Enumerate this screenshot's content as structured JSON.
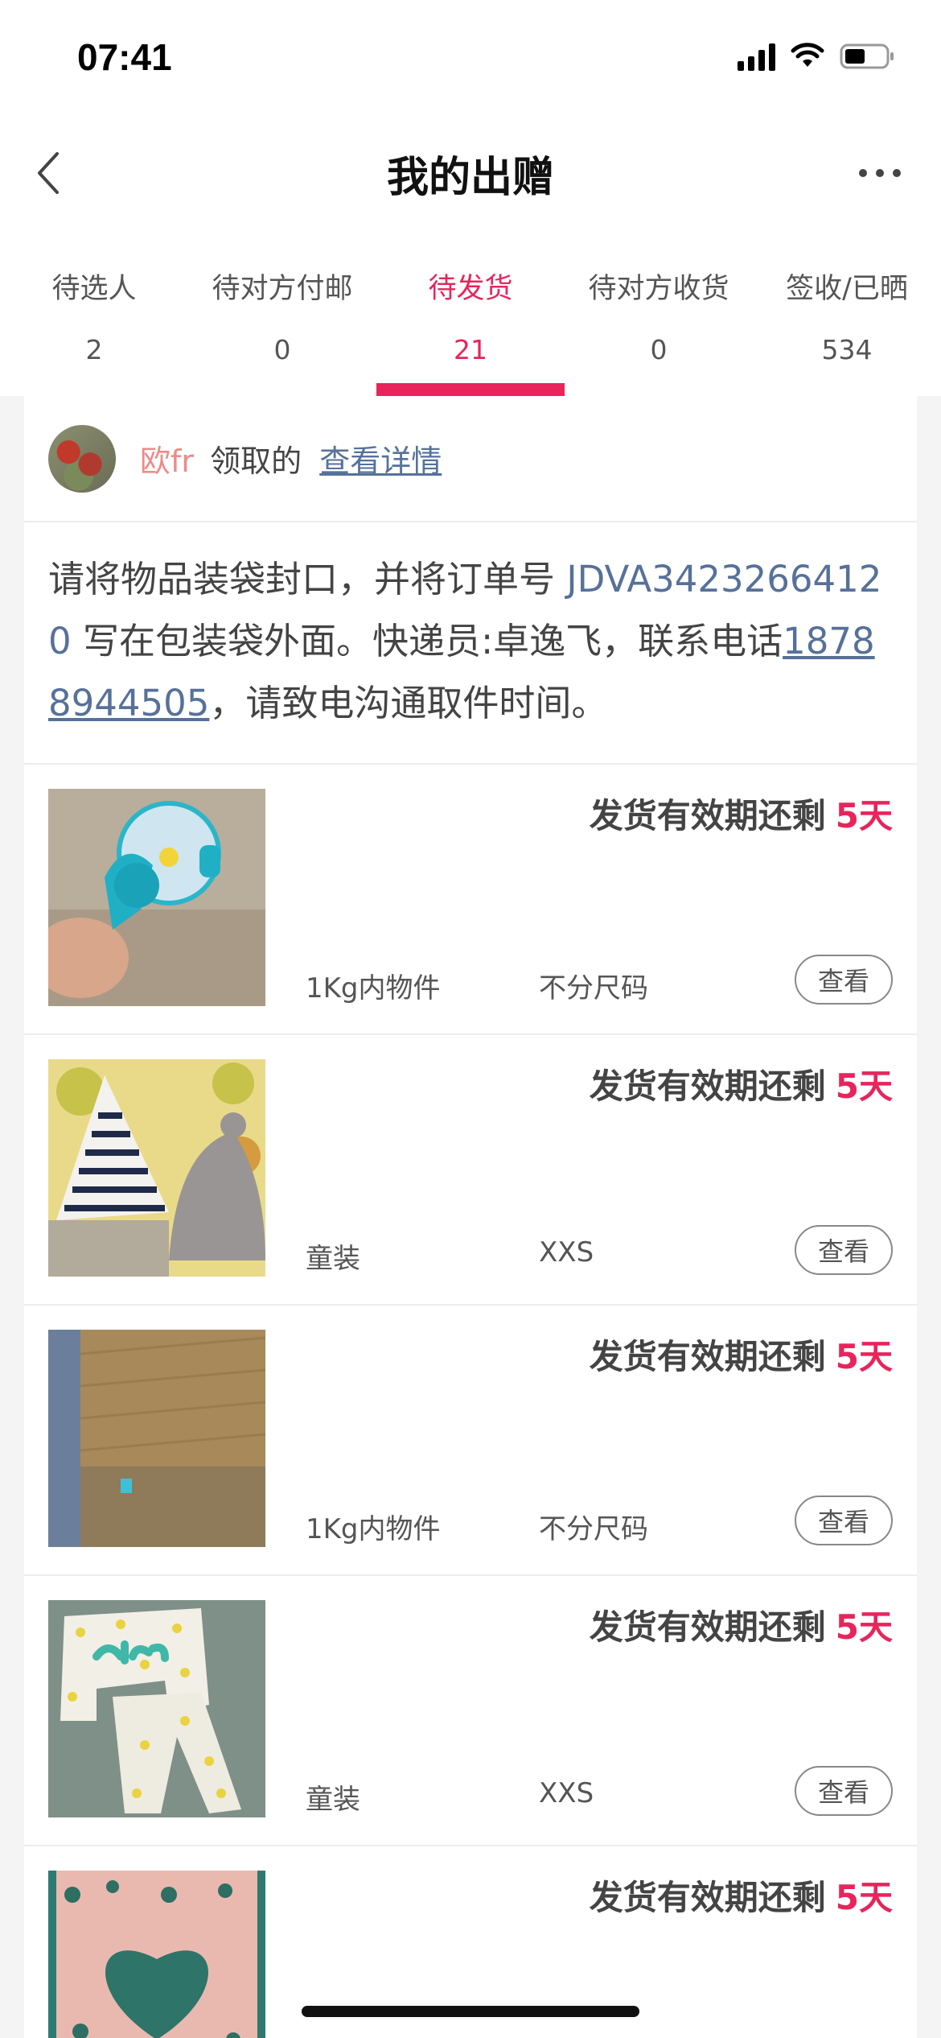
{
  "status_bar": {
    "time": "07:41"
  },
  "nav": {
    "title": "我的出赠"
  },
  "tabs": [
    {
      "label": "待选人",
      "count": "2"
    },
    {
      "label": "待对方付邮",
      "count": "0"
    },
    {
      "label": "待发货",
      "count": "21",
      "active": true
    },
    {
      "label": "待对方收货",
      "count": "0"
    },
    {
      "label": "签收/已晒",
      "count": "534"
    }
  ],
  "receiver": {
    "name": "欧fr",
    "action": "领取的",
    "link": "查看详情"
  },
  "instructions": {
    "part1": "请将物品装袋封口，并将订单号 ",
    "order_number": "JDVA34232664120",
    "part2": " 写在包装袋外面。快递员:卓逸飞，联系电话",
    "phone": "18788944505",
    "part3": "，请致电沟通取件时间。"
  },
  "items": [
    {
      "deadline_label": "发货有效期还剩",
      "days": "5天",
      "category": "1Kg内物件",
      "size": "不分尺码",
      "button": "查看"
    },
    {
      "deadline_label": "发货有效期还剩",
      "days": "5天",
      "category": "童装",
      "size": "XXS",
      "button": "查看"
    },
    {
      "deadline_label": "发货有效期还剩",
      "days": "5天",
      "category": "1Kg内物件",
      "size": "不分尺码",
      "button": "查看"
    },
    {
      "deadline_label": "发货有效期还剩",
      "days": "5天",
      "category": "童装",
      "size": "XXS",
      "button": "查看"
    },
    {
      "deadline_label": "发货有效期还剩",
      "days": "5天",
      "category": "",
      "size": "",
      "button": ""
    }
  ],
  "colors": {
    "accent": "#e8245c",
    "link": "#56719a"
  }
}
